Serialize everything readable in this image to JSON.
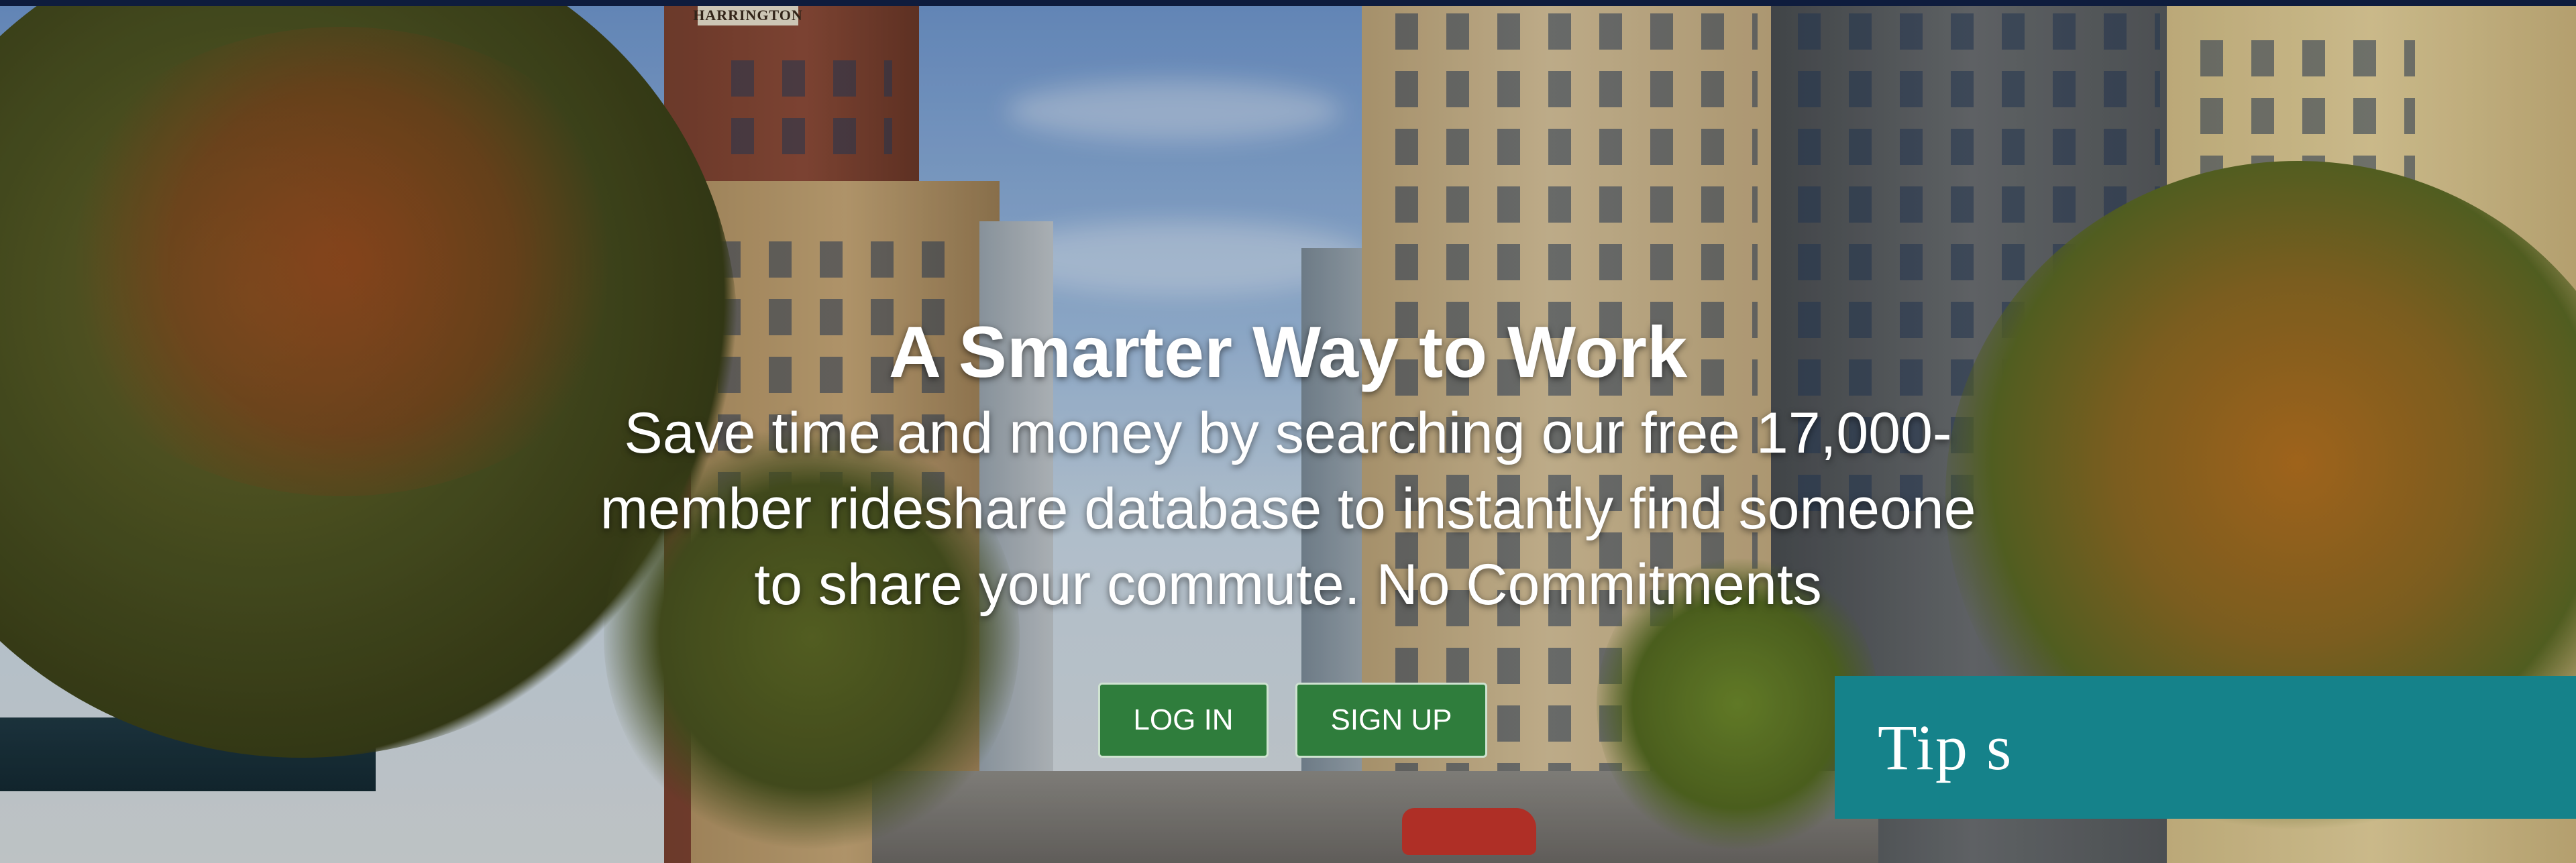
{
  "hero": {
    "headline": "A Smarter Way to Work",
    "subhead": "Save time and money by searching our free 17,000-member rideshare database to instantly find someone to share your commute. No Commitments",
    "background_sign": "HARRINGTON"
  },
  "buttons": {
    "login_label": "LOG IN",
    "signup_label": "SIGN UP"
  },
  "tips": {
    "label": "Tip s"
  },
  "colors": {
    "topbar": "#0e1c3d",
    "button_green": "#2f7d3c",
    "tips_teal": "#15828a",
    "text": "#ffffff"
  }
}
